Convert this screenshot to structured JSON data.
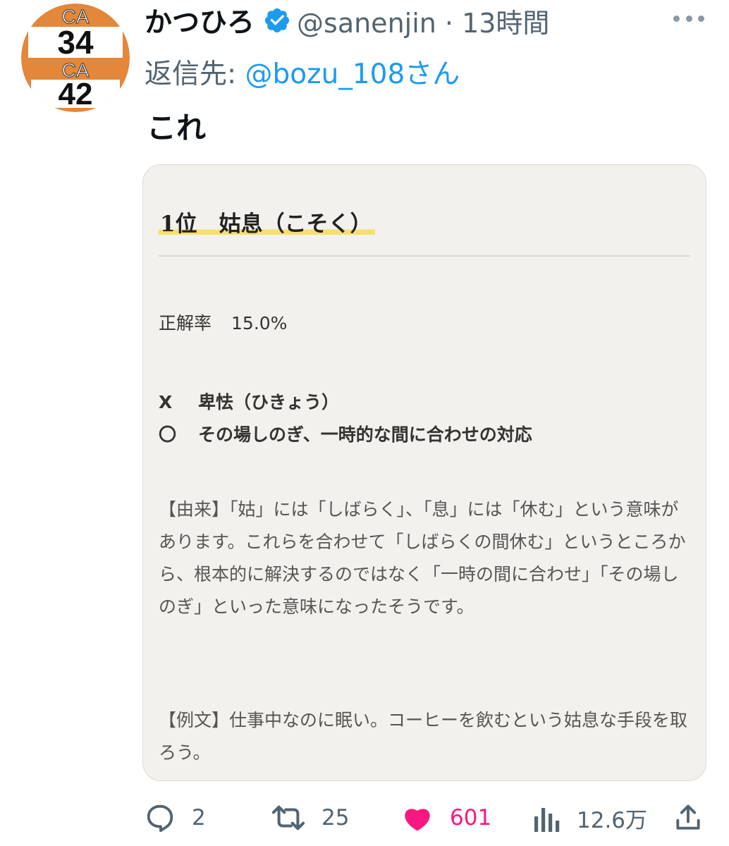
{
  "avatar": {
    "line1": "CA",
    "line2": "34",
    "line3": "CA",
    "line4": "42"
  },
  "tweet": {
    "display_name": "かつひろ",
    "handle_time": "@sanenjin · 13時間",
    "reply_prefix": "返信先: ",
    "reply_to": "@bozu_108さん",
    "text": "これ"
  },
  "card": {
    "title": "1位　姑息（こそく）",
    "rate_label": "正解率",
    "rate_value": "15.0%",
    "wrong_mark": "X",
    "wrong_text": "卑怯（ひきょう）",
    "right_mark": "〇",
    "right_text": "その場しのぎ、一時的な間に合わせの対応",
    "origin": "【由来】「姑」には「しばらく」、「息」には「休む」という意味があります。これらを合わせて「しばらくの間休む」というところから、根本的に解決するのではなく「一時の間に合わせ」「その場しのぎ」といった意味になったそうです。",
    "example": "【例文】仕事中なのに眠い。コーヒーを飲むという姑息な手段を取ろう。"
  },
  "actions": {
    "replies": "2",
    "retweets": "25",
    "likes": "601",
    "views": "12.6万"
  },
  "colors": {
    "accent": "#1d9bf0",
    "like": "#f91880",
    "highlight": "#f7e06a",
    "avatar_orange": "#e3873a"
  }
}
